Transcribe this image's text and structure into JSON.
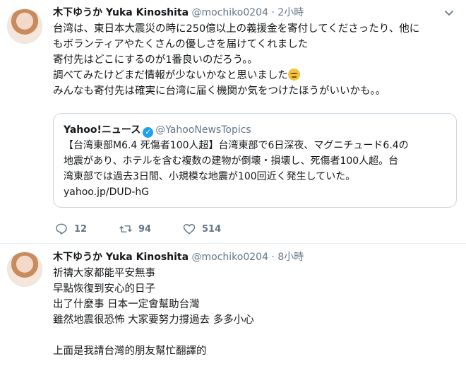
{
  "tweets": [
    {
      "name": "木下ゆうか Yuka Kinoshita",
      "handle": "@mochiko0204",
      "separator": "·",
      "time": "2小時",
      "lines": [
        "台湾は、東日本大震災の時に250億以上の義援金を寄付してくださったり、他に",
        "もボランティアやたくさんの優しさを届けてくれました",
        "寄付先はどこにするのが1番良いのだろう。。",
        "調べてみたけどまだ情報が少ないかなと思いました",
        "みんなも寄付先は確実に台湾に届く機関か気をつけたほうがいいかも。。"
      ],
      "quote": {
        "name": "Yahoo!ニュース",
        "handle": "@YahooNewsTopics",
        "lines": [
          "【台湾東部M6.4 死傷者100人超】台湾東部で6日深夜、マグニチュード6.4の",
          "地震があり、ホテルを含む複数の建物が倒壊・損壊し、死傷者100人超。台",
          "湾東部では過去3日間、小規模な地震が100回近く発生していた。",
          "yahoo.jp/DUD-hG"
        ]
      },
      "actions": {
        "reply_count": "12",
        "retweet_count": "94",
        "like_count": "514"
      }
    },
    {
      "name": "木下ゆうか Yuka Kinoshita",
      "handle": "@mochiko0204",
      "separator": "·",
      "time": "8小時",
      "lines": [
        "祈禱大家都能平安無事",
        "早點恢復到安心的日子",
        "出了什麼事 日本一定會幫助台灣",
        "雖然地震很恐怖 大家要努力撐過去 多多小心",
        "",
        "上面是我請台灣的朋友幫忙翻譯的"
      ]
    }
  ],
  "icons": {
    "chevron": "chevron-down-icon",
    "reply": "reply-icon",
    "retweet": "retweet-icon",
    "like": "heart-icon",
    "verified": "verified-badge-icon",
    "emoji": "relieved-face-emoji"
  },
  "colors": {
    "secondary_text": "#657786",
    "verified": "#1da1f2",
    "border": "#ccd6dd"
  }
}
